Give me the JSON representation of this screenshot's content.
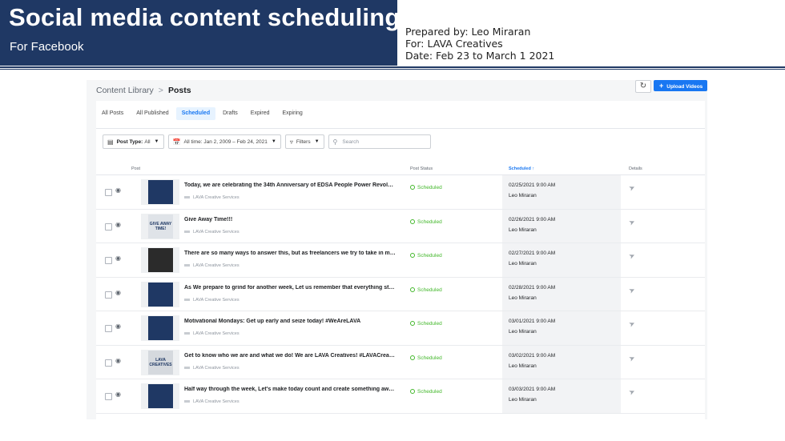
{
  "header": {
    "title": "Social media content scheduling",
    "subtitle": "For Facebook",
    "prepared_by": "Prepared by: Leo Miraran",
    "for": "For: LAVA Creatives",
    "date": "Date: Feb 23 to March 1 2021"
  },
  "app": {
    "breadcrumb_root": "Content Library",
    "breadcrumb_sep": ">",
    "breadcrumb_current": "Posts",
    "refresh_icon": "refresh-icon",
    "upload_label": "Upload Videos"
  },
  "tabs": [
    "All Posts",
    "All Published",
    "Scheduled",
    "Drafts",
    "Expired",
    "Expiring"
  ],
  "active_tab": "Scheduled",
  "filters": {
    "post_type_label": "Post Type:",
    "post_type_value": "All",
    "date_range": "All time: Jan 2, 2009 – Feb 24, 2021",
    "filters_label": "Filters",
    "search_placeholder": "Search"
  },
  "columns": {
    "post": "Post",
    "status": "Post Status",
    "scheduled": "Scheduled ↑",
    "details": "Details"
  },
  "rows": [
    {
      "text": "Today, we are celebrating the 34th Anniversary of EDSA People Power Revolution. Neve...",
      "author": "LAVA Creative Services",
      "status": "Scheduled",
      "time": "02/25/2021 9:00 AM",
      "by": "Leo Miraran",
      "thumb_bg": "#1f3864",
      "thumb_fg": "#f5d300",
      "thumb_text": ""
    },
    {
      "text": "Give Away Time!!!",
      "author": "LAVA Creative Services",
      "status": "Scheduled",
      "time": "02/26/2021 9:00 AM",
      "by": "Leo Miraran",
      "thumb_bg": "#dfe3e8",
      "thumb_fg": "#1f3864",
      "thumb_text": "GIVE AWAY TIME!"
    },
    {
      "text": "There are so many ways to answer this, but as freelancers we try to take in more inspira...",
      "author": "LAVA Creative Services",
      "status": "Scheduled",
      "time": "02/27/2021 9:00 AM",
      "by": "Leo Miraran",
      "thumb_bg": "#2b2b2b",
      "thumb_fg": "#ffffff",
      "thumb_text": ""
    },
    {
      "text": "As We prepare to grind for another week, Let us remember that everything starts with o...",
      "author": "LAVA Creative Services",
      "status": "Scheduled",
      "time": "02/28/2021 9:00 AM",
      "by": "Leo Miraran",
      "thumb_bg": "#1f3864",
      "thumb_fg": "#ffffff",
      "thumb_text": ""
    },
    {
      "text": "Motivational Mondays: Get up early and seize today! #WeAreLAVA",
      "author": "LAVA Creative Services",
      "status": "Scheduled",
      "time": "03/01/2021 9:00 AM",
      "by": "Leo Miraran",
      "thumb_bg": "#1f3864",
      "thumb_fg": "#ffffff",
      "thumb_text": ""
    },
    {
      "text": "Get to know who we are and what we do! We are LAVA Creatives! #LAVACreatives #WeA...",
      "author": "LAVA Creative Services",
      "status": "Scheduled",
      "time": "03/02/2021 9:00 AM",
      "by": "Leo Miraran",
      "thumb_bg": "#d5d9de",
      "thumb_fg": "#1f3864",
      "thumb_text": "LAVA CREATIVES"
    },
    {
      "text": "Half way through the week, Let's make today count and create something awesome! #W...",
      "author": "LAVA Creative Services",
      "status": "Scheduled",
      "time": "03/03/2021 9:00 AM",
      "by": "Leo Miraran",
      "thumb_bg": "#1f3864",
      "thumb_fg": "#ffffff",
      "thumb_text": ""
    }
  ],
  "colors": {
    "brand_navy": "#1f3864",
    "facebook_blue": "#1877f2",
    "status_green": "#42b72a"
  }
}
